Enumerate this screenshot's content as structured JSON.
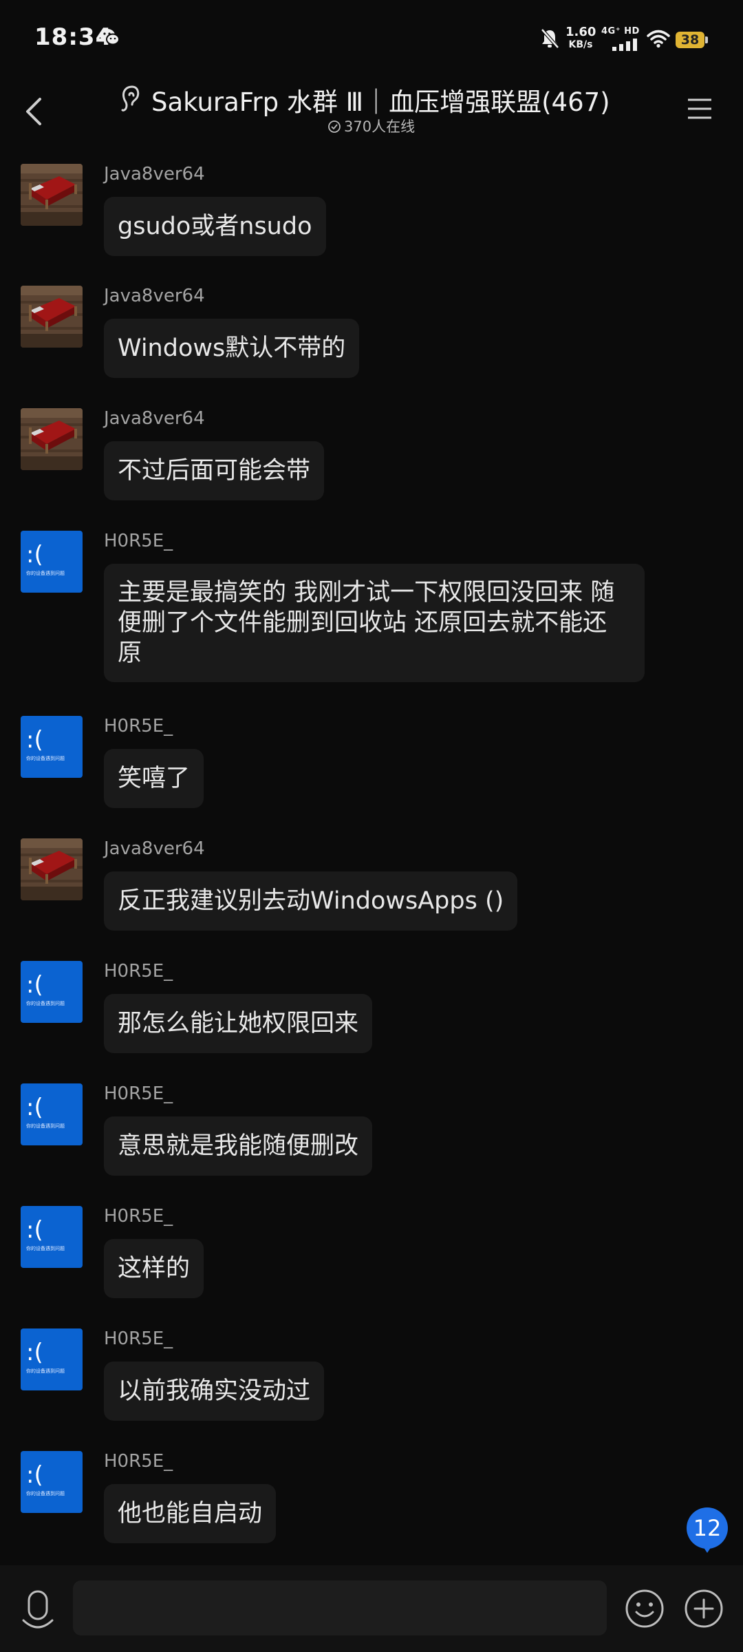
{
  "status_bar": {
    "time": "18:34",
    "net_speed_value": "1.60",
    "net_speed_unit": "KB/s",
    "network_type": "4G⁺ HD",
    "battery_level": "38",
    "battery_color": "#e0b433",
    "icons": [
      "wechat-icon",
      "mute-icon",
      "signal-icon",
      "wifi-icon",
      "battery-icon"
    ]
  },
  "header": {
    "title": "SakuraFrp 水群 Ⅲ｜血压增强联盟(467)",
    "online_count": "370人在线",
    "icons": [
      "back-icon",
      "group-icon",
      "menu-icon"
    ]
  },
  "messages": [
    {
      "sender": "Java8ver64",
      "avatar": "bed-avatar",
      "text": "gsudo或者nsudo"
    },
    {
      "sender": "Java8ver64",
      "avatar": "bed-avatar",
      "text": "Windows默认不带的"
    },
    {
      "sender": "Java8ver64",
      "avatar": "bed-avatar",
      "text": "不过后面可能会带"
    },
    {
      "sender": "H0R5E_",
      "avatar": "bsod-avatar",
      "text": "主要是最搞笑的 我刚才试一下权限回没回来 随便删了个文件能删到回收站 还原回去就不能还原"
    },
    {
      "sender": "H0R5E_",
      "avatar": "bsod-avatar",
      "text": "笑嘻了"
    },
    {
      "sender": "Java8ver64",
      "avatar": "bed-avatar",
      "text": "反正我建议别去动WindowsApps ()"
    },
    {
      "sender": "H0R5E_",
      "avatar": "bsod-avatar",
      "text": "那怎么能让她权限回来"
    },
    {
      "sender": "H0R5E_",
      "avatar": "bsod-avatar",
      "text": "意思就是我能随便删改"
    },
    {
      "sender": "H0R5E_",
      "avatar": "bsod-avatar",
      "text": "这样的"
    },
    {
      "sender": "H0R5E_",
      "avatar": "bsod-avatar",
      "text": "以前我确实没动过"
    },
    {
      "sender": "H0R5E_",
      "avatar": "bsod-avatar",
      "text": "他也能自启动"
    }
  ],
  "avatars": {
    "bsod_face": ":(",
    "bsod_caption": "你的设备遇到问题"
  },
  "unread_badge": {
    "count": "12",
    "color": "#1f6fe6"
  },
  "input_bar": {
    "placeholder": "",
    "value": "",
    "icons": [
      "voice-icon",
      "emoji-icon",
      "plus-icon"
    ]
  }
}
